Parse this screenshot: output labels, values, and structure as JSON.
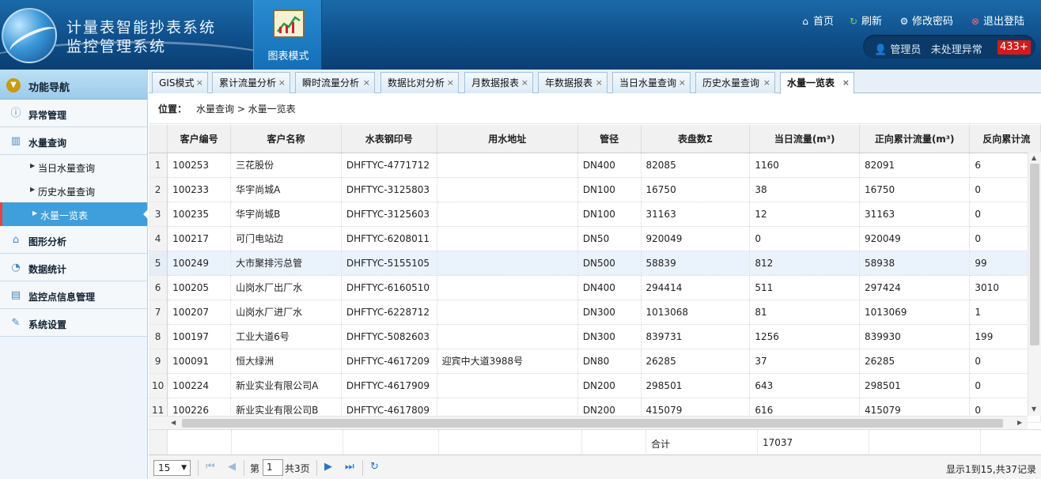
{
  "header": {
    "title_line1": "计量表智能抄表系统",
    "title_line2": "监控管理系统",
    "chart_mode_label": "图表模式",
    "links": {
      "home": "首页",
      "refresh": "刷新",
      "change_password": "修改密码",
      "logout": "退出登陆"
    },
    "user_label": "管理员",
    "exceptions_label": "未处理异常",
    "exceptions_count": "433+"
  },
  "sidebar": {
    "title": "功能导航",
    "items": [
      {
        "label": "异常管理",
        "icon": "info-icon"
      },
      {
        "label": "水量查询",
        "icon": "bar-chart-icon"
      },
      {
        "label": "图形分析",
        "icon": "graph-icon"
      },
      {
        "label": "数据统计",
        "icon": "pie-icon"
      },
      {
        "label": "监控点信息管理",
        "icon": "doc-icon"
      },
      {
        "label": "系统设置",
        "icon": "wrench-icon"
      }
    ],
    "subitems": [
      "当日水量查询",
      "历史水量查询",
      "水量一览表"
    ]
  },
  "tabs": [
    "GIS模式",
    "累计流量分析",
    "瞬时流量分析",
    "数据比对分析",
    "月数据报表",
    "年数据报表",
    "当日水量查询",
    "历史水量查询",
    "水量一览表"
  ],
  "breadcrumb": {
    "label": "位置：",
    "path": "水量查询 > 水量一览表"
  },
  "table": {
    "columns": [
      "客户编号",
      "客户名称",
      "水表钢印号",
      "用水地址",
      "管径",
      "表盘数Σ",
      "当日流量(m³)",
      "正向累计流量(m³)",
      "反向累计流"
    ],
    "rows": [
      [
        "1",
        "100253",
        "三花股份",
        "DHFTYC-4771712",
        "",
        "DN400",
        "82085",
        "1160",
        "82091",
        "6"
      ],
      [
        "2",
        "100233",
        "华宇尚城A",
        "DHFTYC-3125803",
        "",
        "DN100",
        "16750",
        "38",
        "16750",
        "0"
      ],
      [
        "3",
        "100235",
        "华宇尚城B",
        "DHFTYC-3125603",
        "",
        "DN100",
        "31163",
        "12",
        "31163",
        "0"
      ],
      [
        "4",
        "100217",
        "可门电站边",
        "DHFTYC-6208011",
        "",
        "DN50",
        "920049",
        "0",
        "920049",
        "0"
      ],
      [
        "5",
        "100249",
        "大市聚排污总管",
        "DHFTYC-5155105",
        "",
        "DN500",
        "58839",
        "812",
        "58938",
        "99"
      ],
      [
        "6",
        "100205",
        "山岗水厂出厂水",
        "DHFTYC-6160510",
        "",
        "DN400",
        "294414",
        "511",
        "297424",
        "3010"
      ],
      [
        "7",
        "100207",
        "山岗水厂进厂水",
        "DHFTYC-6228712",
        "",
        "DN300",
        "1013068",
        "81",
        "1013069",
        "1"
      ],
      [
        "8",
        "100197",
        "工业大道6号",
        "DHFTYC-5082603",
        "",
        "DN300",
        "839731",
        "1256",
        "839930",
        "199"
      ],
      [
        "9",
        "100091",
        "恒大绿洲",
        "DHFTYC-4617209",
        "迎宾中大道3988号",
        "DN80",
        "26285",
        "37",
        "26285",
        "0"
      ],
      [
        "10",
        "100224",
        "新业实业有限公司A",
        "DHFTYC-4617909",
        "",
        "DN200",
        "298501",
        "643",
        "298501",
        "0"
      ],
      [
        "11",
        "100226",
        "新业实业有限公司B",
        "DHFTYC-4617809",
        "",
        "DN200",
        "415079",
        "616",
        "415079",
        "0"
      ]
    ],
    "total_label": "合计",
    "total_value": "17037"
  },
  "pager": {
    "page_size": "15",
    "page_prefix": "第",
    "page_value": "1",
    "page_suffix": "共3页",
    "info": "显示1到15,共37记录"
  }
}
